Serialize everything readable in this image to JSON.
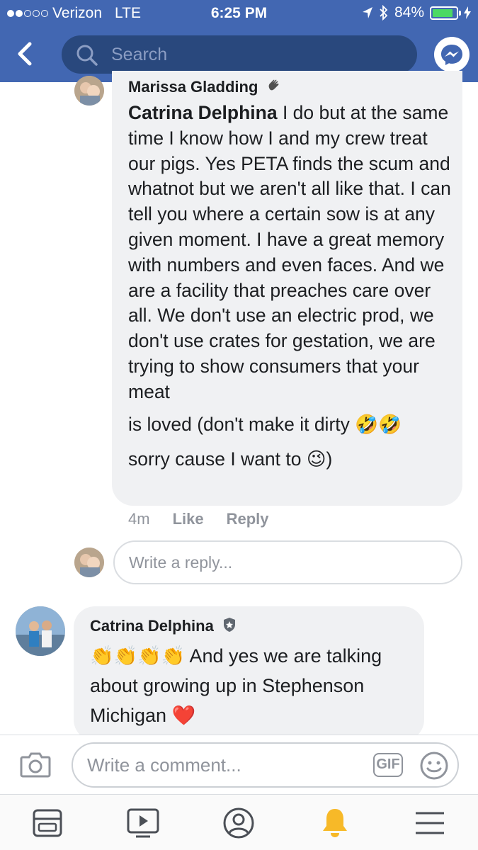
{
  "status_bar": {
    "carrier": "Verizon",
    "network": "LTE",
    "time": "6:25 PM",
    "battery_percent": "84%",
    "signal_bars_filled": 2,
    "signal_bars_total": 5,
    "battery_level": 0.84
  },
  "header": {
    "search_placeholder": "Search",
    "back_icon": "chevron-left-icon",
    "messenger_icon": "messenger-icon"
  },
  "thread": {
    "reply": {
      "author": "Marissa Gladding",
      "mention": "Catrina Delphina",
      "text_line1": " I do but at the",
      "text_rest": "same time I know how I and my crew treat our pigs. Yes PETA finds the scum and whatnot but we aren't all like that. I can tell you where a certain sow is at any given moment. I have a great memory with numbers and even faces. And we are a facility that preaches care over all. We don't use an electric prod, we don't use crates for gestation, we are trying to show consumers that your meat",
      "text_end1": "is loved (don't make it dirty",
      "emoji_end1": "🤣🤣",
      "text_end2": "sorry cause I want to",
      "emoji_end2": "😉",
      "text_end3": ")",
      "timestamp": "4m",
      "like_label": "Like",
      "reply_label": "Reply"
    },
    "reply_input_placeholder": "Write a reply...",
    "comment": {
      "author": "Catrina Delphina",
      "emoji_start": "👏👏👏👏",
      "text1": " And yes we are talking",
      "text2": "about growing up in Stephenson",
      "text3": "Michigan",
      "emoji_end": "❤️"
    }
  },
  "composer": {
    "placeholder": "Write a comment...",
    "gif_label": "GIF"
  },
  "tabbar": {
    "tabs": [
      "news-feed-icon",
      "watch-icon",
      "profile-icon",
      "notifications-icon",
      "menu-icon"
    ],
    "active_tab": "notifications-icon",
    "active_color": "#f7b928"
  }
}
